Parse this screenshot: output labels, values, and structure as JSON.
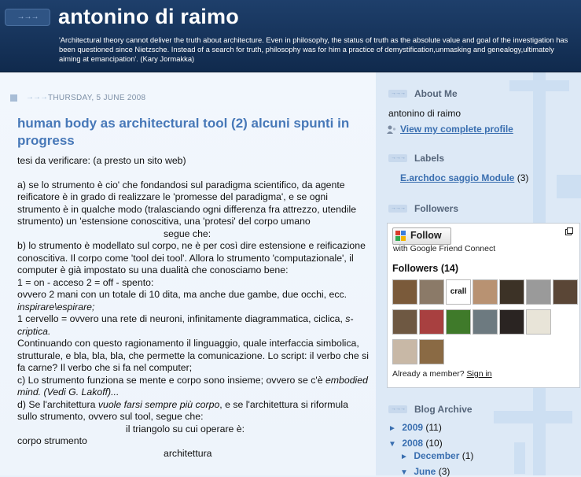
{
  "header": {
    "title": "antonino di raimo",
    "description": "'Architectural theory cannot deliver the truth about architecture. Even in philosophy, the status of truth as the absolute value and goal of the investigation has been questioned since Nietzsche. Instead of a search for truth, philosophy was for him a practice of demystification,unmasking and genealogy,ultimately aiming at emancipation'. (Kary Jormakka)",
    "arrows_icon": "arrows-icon"
  },
  "post": {
    "date": "Thursday, 5 June 2008",
    "title": "human body as architectural tool (2) alcuni spunti in progress",
    "lines": {
      "l1": "tesi da verificare: (a presto un sito web)",
      "l2": "a) se lo strumento è cio' che fondandosi sul paradigma scientifico, da agente reificatore è in grado di realizzare le 'promesse del paradigma', e se ogni strumento è in qualche modo (tralasciando ogni differenza fra attrezzo, utendile strumento) un 'estensione conoscitiva, una 'protesi' del corpo umano",
      "l3": "segue che:",
      "l4": "b) lo strumento è modellato sul corpo, ne è per così dire estensione e reificazione conoscitiva. Il corpo come 'tool dei tool'. Allora lo strumento 'computazionale', il computer è già impostato su una dualità che conosciamo bene:",
      "l5": "1 = on - acceso 2 = off - spento:",
      "l6a": "ovvero 2 mani con un totale di 10 dita, ma anche due gambe, due occhi, ecc. ",
      "l6b": "inspirare\\espirare;",
      "l7a": "1 cervello = ovvero una rete di neuroni, infinitamente diagrammatica, ciclica, ",
      "l7b": "s-criptica.",
      "l8": "Continuando con questo ragionamento il linguaggio, quale interfaccia simbolica, strutturale, e bla, bla, bla, che permette la comunicazione. Lo script: il verbo che si fa carne? Il verbo che si fa nel computer;",
      "l9a": "c) Lo strumento funziona se mente e corpo sono insieme; ovvero se c'è ",
      "l9b": "embodied mind. (Vedi G. Lakoff)...",
      "l10a": "d) Se l'architettura ",
      "l10b": "vuole farsi sempre più corpo",
      "l10c": ", e se l'architettura si riformula sullo strumento, ovvero sul tool, segue che:",
      "l11": "il triangolo su cui operare è:",
      "l12": "corpo strumento",
      "l13": "architettura"
    }
  },
  "sidebar": {
    "about": {
      "title": "About Me",
      "name": "antonino di raimo",
      "profile_link": "View my complete profile"
    },
    "labels": {
      "title": "Labels",
      "items": [
        {
          "label": "E.archdoc saggio Module",
          "count": "(3)"
        }
      ]
    },
    "followers": {
      "title": "Followers",
      "follow_button": "Follow",
      "gfc": "with Google Friend Connect",
      "count_title": "Followers (14)",
      "avatars": [
        {
          "color": "#7a5a3a"
        },
        {
          "color": "#8b7a68"
        },
        {
          "color": "#ffffff",
          "text": "crall"
        },
        {
          "color": "#b89272"
        },
        {
          "color": "#3c3226"
        },
        {
          "color": "#9a9a9a"
        },
        {
          "color": "#5a4636"
        },
        {
          "color": "#6e5842"
        },
        {
          "color": "#a84040"
        },
        {
          "color": "#3f7a2a"
        },
        {
          "color": "#6d7a80"
        },
        {
          "color": "#2a2422"
        },
        {
          "color": "#e8e4d8"
        },
        {
          "color": "#c8b8a6"
        },
        {
          "color": "#8a6a44"
        }
      ],
      "already_member": "Already a member?",
      "sign_in": "Sign in"
    },
    "archive": {
      "title": "Blog Archive",
      "years": [
        {
          "toggle": "►",
          "label": "2009",
          "count": "(11)"
        },
        {
          "toggle": "▼",
          "label": "2008",
          "count": "(10)"
        }
      ],
      "months": [
        {
          "toggle": "►",
          "label": "December",
          "count": "(1)"
        },
        {
          "toggle": "▼",
          "label": "June",
          "count": "(3)"
        }
      ]
    }
  },
  "colors": {
    "header_bg": "#1a365e",
    "accent": "#4778b8",
    "link": "#3a6fb0"
  }
}
